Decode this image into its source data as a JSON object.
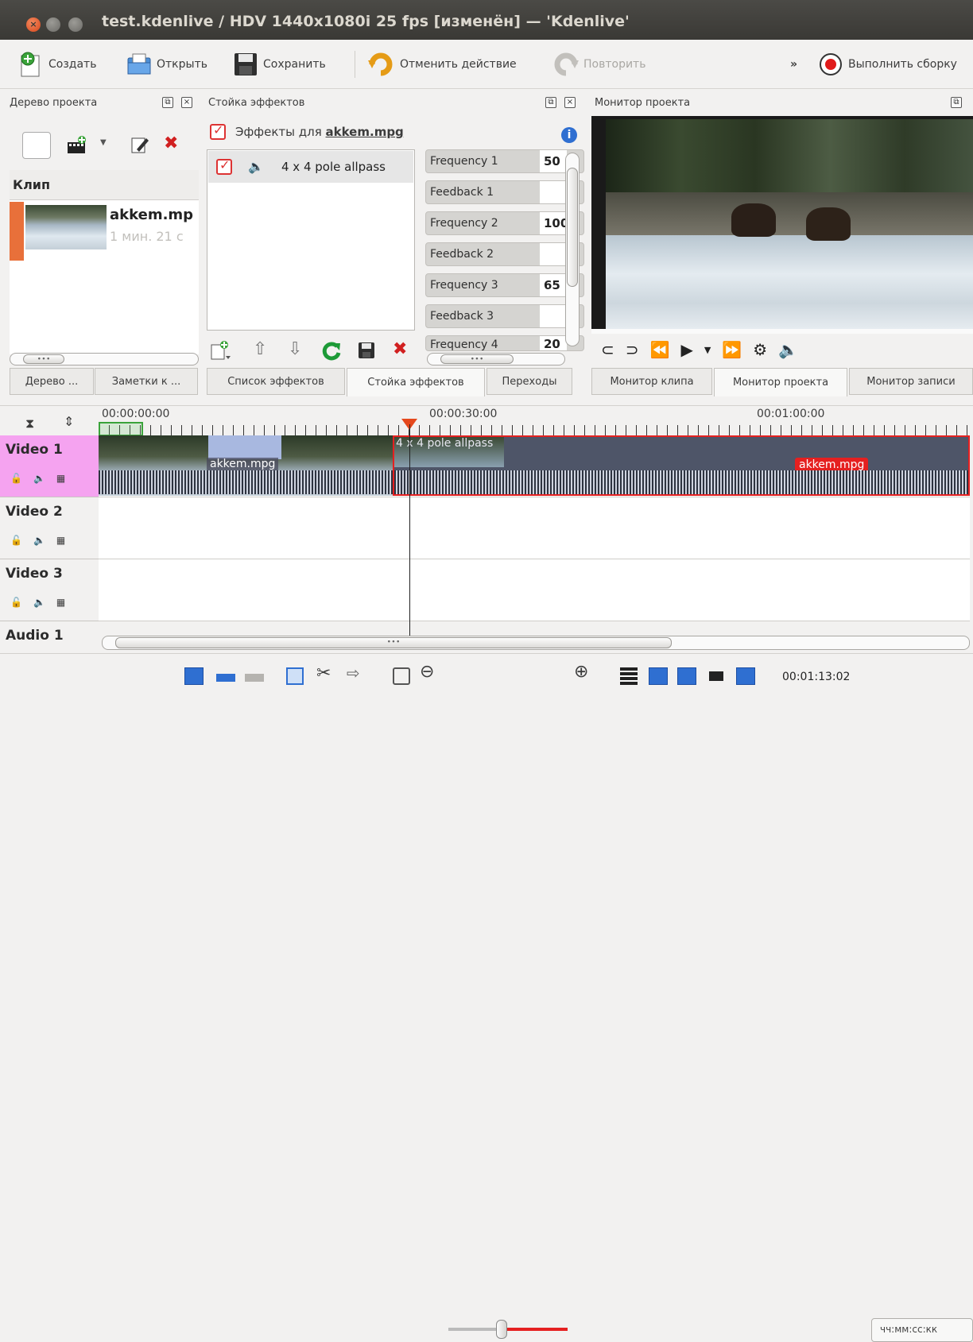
{
  "window": {
    "title": "test.kdenlive / HDV 1440x1080i 25 fps [изменён] — 'Kdenlive'"
  },
  "toolbar": {
    "new": "Создать",
    "open": "Открыть",
    "save": "Сохранить",
    "undo": "Отменить действие",
    "redo": "Повторить",
    "more": "»",
    "render": "Выполнить сборку"
  },
  "project_tree": {
    "title": "Дерево проекта",
    "column_header": "Клип",
    "clip_name": "akkem.mp",
    "clip_duration": "1 мин. 21 с",
    "tabs": [
      "Дерево ...",
      "Заметки к ..."
    ]
  },
  "effect_stack": {
    "title": "Стойка эффектов",
    "effects_for_label": "Эффекты для ",
    "effects_for_file": "akkem.mpg",
    "effect_item": "4 x 4 pole allpass",
    "params": [
      {
        "label": "Frequency 1",
        "value": "50"
      },
      {
        "label": "Feedback 1",
        "value": ""
      },
      {
        "label": "Frequency 2",
        "value": "100"
      },
      {
        "label": "Feedback 2",
        "value": ""
      },
      {
        "label": "Frequency 3",
        "value": "65"
      },
      {
        "label": "Feedback 3",
        "value": ""
      },
      {
        "label": "Frequency 4",
        "value": "20"
      }
    ],
    "tabs": [
      "Список эффектов",
      "Стойка эффектов",
      "Переходы"
    ]
  },
  "monitor": {
    "title": "Монитор проекта",
    "tabs": [
      "Монитор клипа",
      "Монитор проекта",
      "Монитор записи"
    ]
  },
  "timeline": {
    "ruler": [
      "00:00:00:00",
      "00:00:30:00",
      "00:01:00:00"
    ],
    "tracks": [
      "Video 1",
      "Video 2",
      "Video 3",
      "Audio 1"
    ],
    "clip1_label": "akkem.mpg",
    "clip2_effect": "4 x 4 pole allpass",
    "clip2_label": "akkem.mpg"
  },
  "statusbar": {
    "timecode": "00:01:13:02",
    "format": "чч:мм:сс:кк"
  },
  "colors": {
    "accent_red": "#e52020",
    "track_selected": "#f5a3f0",
    "clip_orange": "#e8703a"
  }
}
